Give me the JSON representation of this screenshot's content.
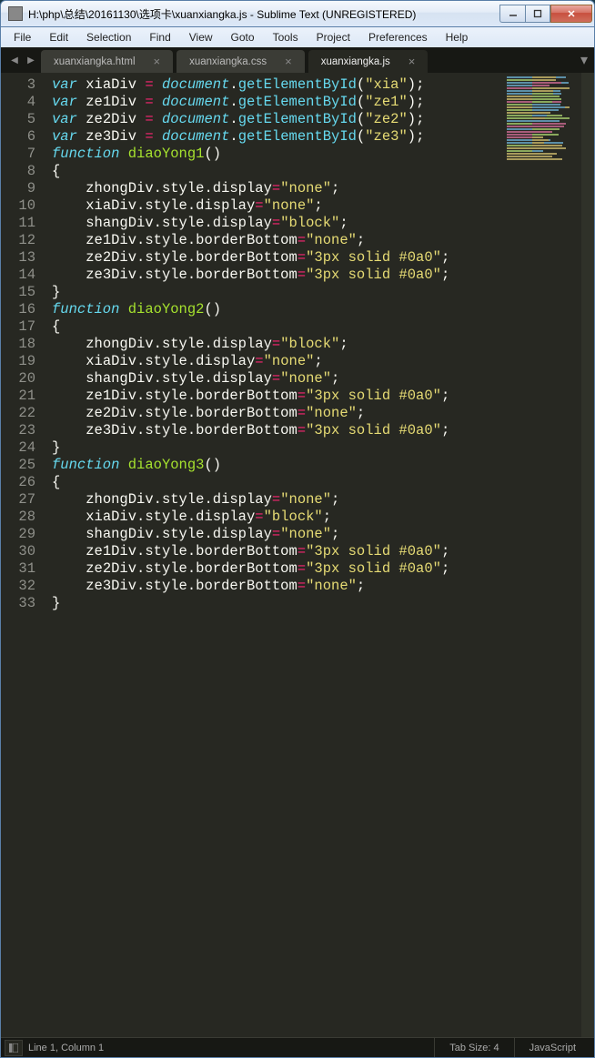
{
  "window": {
    "title": "H:\\php\\总结\\20161130\\选项卡\\xuanxiangka.js - Sublime Text (UNREGISTERED)"
  },
  "menu": {
    "items": [
      "File",
      "Edit",
      "Selection",
      "Find",
      "View",
      "Goto",
      "Tools",
      "Project",
      "Preferences",
      "Help"
    ]
  },
  "tabs": {
    "items": [
      {
        "label": "xuanxiangka.html",
        "active": false
      },
      {
        "label": "xuanxiangka.css",
        "active": false
      },
      {
        "label": "xuanxiangka.js",
        "active": true
      }
    ],
    "close_glyph": "×",
    "nav_prev": "◀",
    "nav_next": "▶",
    "more": "▾"
  },
  "code": {
    "first_line_no": 3,
    "lines": [
      [
        [
          "storage",
          "var"
        ],
        [
          "sp",
          " "
        ],
        [
          "var",
          "xiaDiv"
        ],
        [
          "sp",
          " "
        ],
        [
          "op",
          "="
        ],
        [
          "sp",
          " "
        ],
        [
          "support",
          "document"
        ],
        [
          "punc",
          "."
        ],
        [
          "func",
          "getElementById"
        ],
        [
          "punc",
          "("
        ],
        [
          "str",
          "\"xia\""
        ],
        [
          "punc",
          ")"
        ],
        [
          "punc",
          ";"
        ]
      ],
      [
        [
          "storage",
          "var"
        ],
        [
          "sp",
          " "
        ],
        [
          "var",
          "ze1Div"
        ],
        [
          "sp",
          " "
        ],
        [
          "op",
          "="
        ],
        [
          "sp",
          " "
        ],
        [
          "support",
          "document"
        ],
        [
          "punc",
          "."
        ],
        [
          "func",
          "getElementById"
        ],
        [
          "punc",
          "("
        ],
        [
          "str",
          "\"ze1\""
        ],
        [
          "punc",
          ")"
        ],
        [
          "punc",
          ";"
        ]
      ],
      [
        [
          "storage",
          "var"
        ],
        [
          "sp",
          " "
        ],
        [
          "var",
          "ze2Div"
        ],
        [
          "sp",
          " "
        ],
        [
          "op",
          "="
        ],
        [
          "sp",
          " "
        ],
        [
          "support",
          "document"
        ],
        [
          "punc",
          "."
        ],
        [
          "func",
          "getElementById"
        ],
        [
          "punc",
          "("
        ],
        [
          "str",
          "\"ze2\""
        ],
        [
          "punc",
          ")"
        ],
        [
          "punc",
          ";"
        ]
      ],
      [
        [
          "storage",
          "var"
        ],
        [
          "sp",
          " "
        ],
        [
          "var",
          "ze3Div"
        ],
        [
          "sp",
          " "
        ],
        [
          "op",
          "="
        ],
        [
          "sp",
          " "
        ],
        [
          "support",
          "document"
        ],
        [
          "punc",
          "."
        ],
        [
          "func",
          "getElementById"
        ],
        [
          "punc",
          "("
        ],
        [
          "str",
          "\"ze3\""
        ],
        [
          "punc",
          ")"
        ],
        [
          "punc",
          ";"
        ]
      ],
      [
        [
          "storage",
          "function"
        ],
        [
          "sp",
          " "
        ],
        [
          "name",
          "diaoYong1"
        ],
        [
          "punc",
          "()"
        ]
      ],
      [
        [
          "punc",
          "{"
        ]
      ],
      [
        [
          "indent",
          "    "
        ],
        [
          "var",
          "zhongDiv"
        ],
        [
          "punc",
          "."
        ],
        [
          "prop",
          "style"
        ],
        [
          "punc",
          "."
        ],
        [
          "prop",
          "display"
        ],
        [
          "op",
          "="
        ],
        [
          "str",
          "\"none\""
        ],
        [
          "punc",
          ";"
        ]
      ],
      [
        [
          "indent",
          "    "
        ],
        [
          "var",
          "xiaDiv"
        ],
        [
          "punc",
          "."
        ],
        [
          "prop",
          "style"
        ],
        [
          "punc",
          "."
        ],
        [
          "prop",
          "display"
        ],
        [
          "op",
          "="
        ],
        [
          "str",
          "\"none\""
        ],
        [
          "punc",
          ";"
        ]
      ],
      [
        [
          "indent",
          "    "
        ],
        [
          "var",
          "shangDiv"
        ],
        [
          "punc",
          "."
        ],
        [
          "prop",
          "style"
        ],
        [
          "punc",
          "."
        ],
        [
          "prop",
          "display"
        ],
        [
          "op",
          "="
        ],
        [
          "str",
          "\"block\""
        ],
        [
          "punc",
          ";"
        ]
      ],
      [
        [
          "indent",
          "    "
        ],
        [
          "var",
          "ze1Div"
        ],
        [
          "punc",
          "."
        ],
        [
          "prop",
          "style"
        ],
        [
          "punc",
          "."
        ],
        [
          "prop",
          "borderBottom"
        ],
        [
          "op",
          "="
        ],
        [
          "str",
          "\"none\""
        ],
        [
          "punc",
          ";"
        ]
      ],
      [
        [
          "indent",
          "    "
        ],
        [
          "var",
          "ze2Div"
        ],
        [
          "punc",
          "."
        ],
        [
          "prop",
          "style"
        ],
        [
          "punc",
          "."
        ],
        [
          "prop",
          "borderBottom"
        ],
        [
          "op",
          "="
        ],
        [
          "str",
          "\"3px solid #0a0\""
        ],
        [
          "punc",
          ";"
        ]
      ],
      [
        [
          "indent",
          "    "
        ],
        [
          "var",
          "ze3Div"
        ],
        [
          "punc",
          "."
        ],
        [
          "prop",
          "style"
        ],
        [
          "punc",
          "."
        ],
        [
          "prop",
          "borderBottom"
        ],
        [
          "op",
          "="
        ],
        [
          "str",
          "\"3px solid #0a0\""
        ],
        [
          "punc",
          ";"
        ]
      ],
      [
        [
          "punc",
          "}"
        ]
      ],
      [
        [
          "storage",
          "function"
        ],
        [
          "sp",
          " "
        ],
        [
          "name",
          "diaoYong2"
        ],
        [
          "punc",
          "()"
        ]
      ],
      [
        [
          "punc",
          "{"
        ]
      ],
      [
        [
          "indent",
          "    "
        ],
        [
          "var",
          "zhongDiv"
        ],
        [
          "punc",
          "."
        ],
        [
          "prop",
          "style"
        ],
        [
          "punc",
          "."
        ],
        [
          "prop",
          "display"
        ],
        [
          "op",
          "="
        ],
        [
          "str",
          "\"block\""
        ],
        [
          "punc",
          ";"
        ]
      ],
      [
        [
          "indent",
          "    "
        ],
        [
          "var",
          "xiaDiv"
        ],
        [
          "punc",
          "."
        ],
        [
          "prop",
          "style"
        ],
        [
          "punc",
          "."
        ],
        [
          "prop",
          "display"
        ],
        [
          "op",
          "="
        ],
        [
          "str",
          "\"none\""
        ],
        [
          "punc",
          ";"
        ]
      ],
      [
        [
          "indent",
          "    "
        ],
        [
          "var",
          "shangDiv"
        ],
        [
          "punc",
          "."
        ],
        [
          "prop",
          "style"
        ],
        [
          "punc",
          "."
        ],
        [
          "prop",
          "display"
        ],
        [
          "op",
          "="
        ],
        [
          "str",
          "\"none\""
        ],
        [
          "punc",
          ";"
        ]
      ],
      [
        [
          "indent",
          "    "
        ],
        [
          "var",
          "ze1Div"
        ],
        [
          "punc",
          "."
        ],
        [
          "prop",
          "style"
        ],
        [
          "punc",
          "."
        ],
        [
          "prop",
          "borderBottom"
        ],
        [
          "op",
          "="
        ],
        [
          "str",
          "\"3px solid #0a0\""
        ],
        [
          "punc",
          ";"
        ]
      ],
      [
        [
          "indent",
          "    "
        ],
        [
          "var",
          "ze2Div"
        ],
        [
          "punc",
          "."
        ],
        [
          "prop",
          "style"
        ],
        [
          "punc",
          "."
        ],
        [
          "prop",
          "borderBottom"
        ],
        [
          "op",
          "="
        ],
        [
          "str",
          "\"none\""
        ],
        [
          "punc",
          ";"
        ]
      ],
      [
        [
          "indent",
          "    "
        ],
        [
          "var",
          "ze3Div"
        ],
        [
          "punc",
          "."
        ],
        [
          "prop",
          "style"
        ],
        [
          "punc",
          "."
        ],
        [
          "prop",
          "borderBottom"
        ],
        [
          "op",
          "="
        ],
        [
          "str",
          "\"3px solid #0a0\""
        ],
        [
          "punc",
          ";"
        ]
      ],
      [
        [
          "punc",
          "}"
        ]
      ],
      [
        [
          "storage",
          "function"
        ],
        [
          "sp",
          " "
        ],
        [
          "name",
          "diaoYong3"
        ],
        [
          "punc",
          "()"
        ]
      ],
      [
        [
          "punc",
          "{"
        ]
      ],
      [
        [
          "indent",
          "    "
        ],
        [
          "var",
          "zhongDiv"
        ],
        [
          "punc",
          "."
        ],
        [
          "prop",
          "style"
        ],
        [
          "punc",
          "."
        ],
        [
          "prop",
          "display"
        ],
        [
          "op",
          "="
        ],
        [
          "str",
          "\"none\""
        ],
        [
          "punc",
          ";"
        ]
      ],
      [
        [
          "indent",
          "    "
        ],
        [
          "var",
          "xiaDiv"
        ],
        [
          "punc",
          "."
        ],
        [
          "prop",
          "style"
        ],
        [
          "punc",
          "."
        ],
        [
          "prop",
          "display"
        ],
        [
          "op",
          "="
        ],
        [
          "str",
          "\"block\""
        ],
        [
          "punc",
          ";"
        ]
      ],
      [
        [
          "indent",
          "    "
        ],
        [
          "var",
          "shangDiv"
        ],
        [
          "punc",
          "."
        ],
        [
          "prop",
          "style"
        ],
        [
          "punc",
          "."
        ],
        [
          "prop",
          "display"
        ],
        [
          "op",
          "="
        ],
        [
          "str",
          "\"none\""
        ],
        [
          "punc",
          ";"
        ]
      ],
      [
        [
          "indent",
          "    "
        ],
        [
          "var",
          "ze1Div"
        ],
        [
          "punc",
          "."
        ],
        [
          "prop",
          "style"
        ],
        [
          "punc",
          "."
        ],
        [
          "prop",
          "borderBottom"
        ],
        [
          "op",
          "="
        ],
        [
          "str",
          "\"3px solid #0a0\""
        ],
        [
          "punc",
          ";"
        ]
      ],
      [
        [
          "indent",
          "    "
        ],
        [
          "var",
          "ze2Div"
        ],
        [
          "punc",
          "."
        ],
        [
          "prop",
          "style"
        ],
        [
          "punc",
          "."
        ],
        [
          "prop",
          "borderBottom"
        ],
        [
          "op",
          "="
        ],
        [
          "str",
          "\"3px solid #0a0\""
        ],
        [
          "punc",
          ";"
        ]
      ],
      [
        [
          "indent",
          "    "
        ],
        [
          "var",
          "ze3Div"
        ],
        [
          "punc",
          "."
        ],
        [
          "prop",
          "style"
        ],
        [
          "punc",
          "."
        ],
        [
          "prop",
          "borderBottom"
        ],
        [
          "op",
          "="
        ],
        [
          "str",
          "\"none\""
        ],
        [
          "punc",
          ";"
        ]
      ],
      [
        [
          "punc",
          "}"
        ]
      ]
    ]
  },
  "status": {
    "position": "Line 1, Column 1",
    "tab_size": "Tab Size: 4",
    "syntax": "JavaScript"
  }
}
